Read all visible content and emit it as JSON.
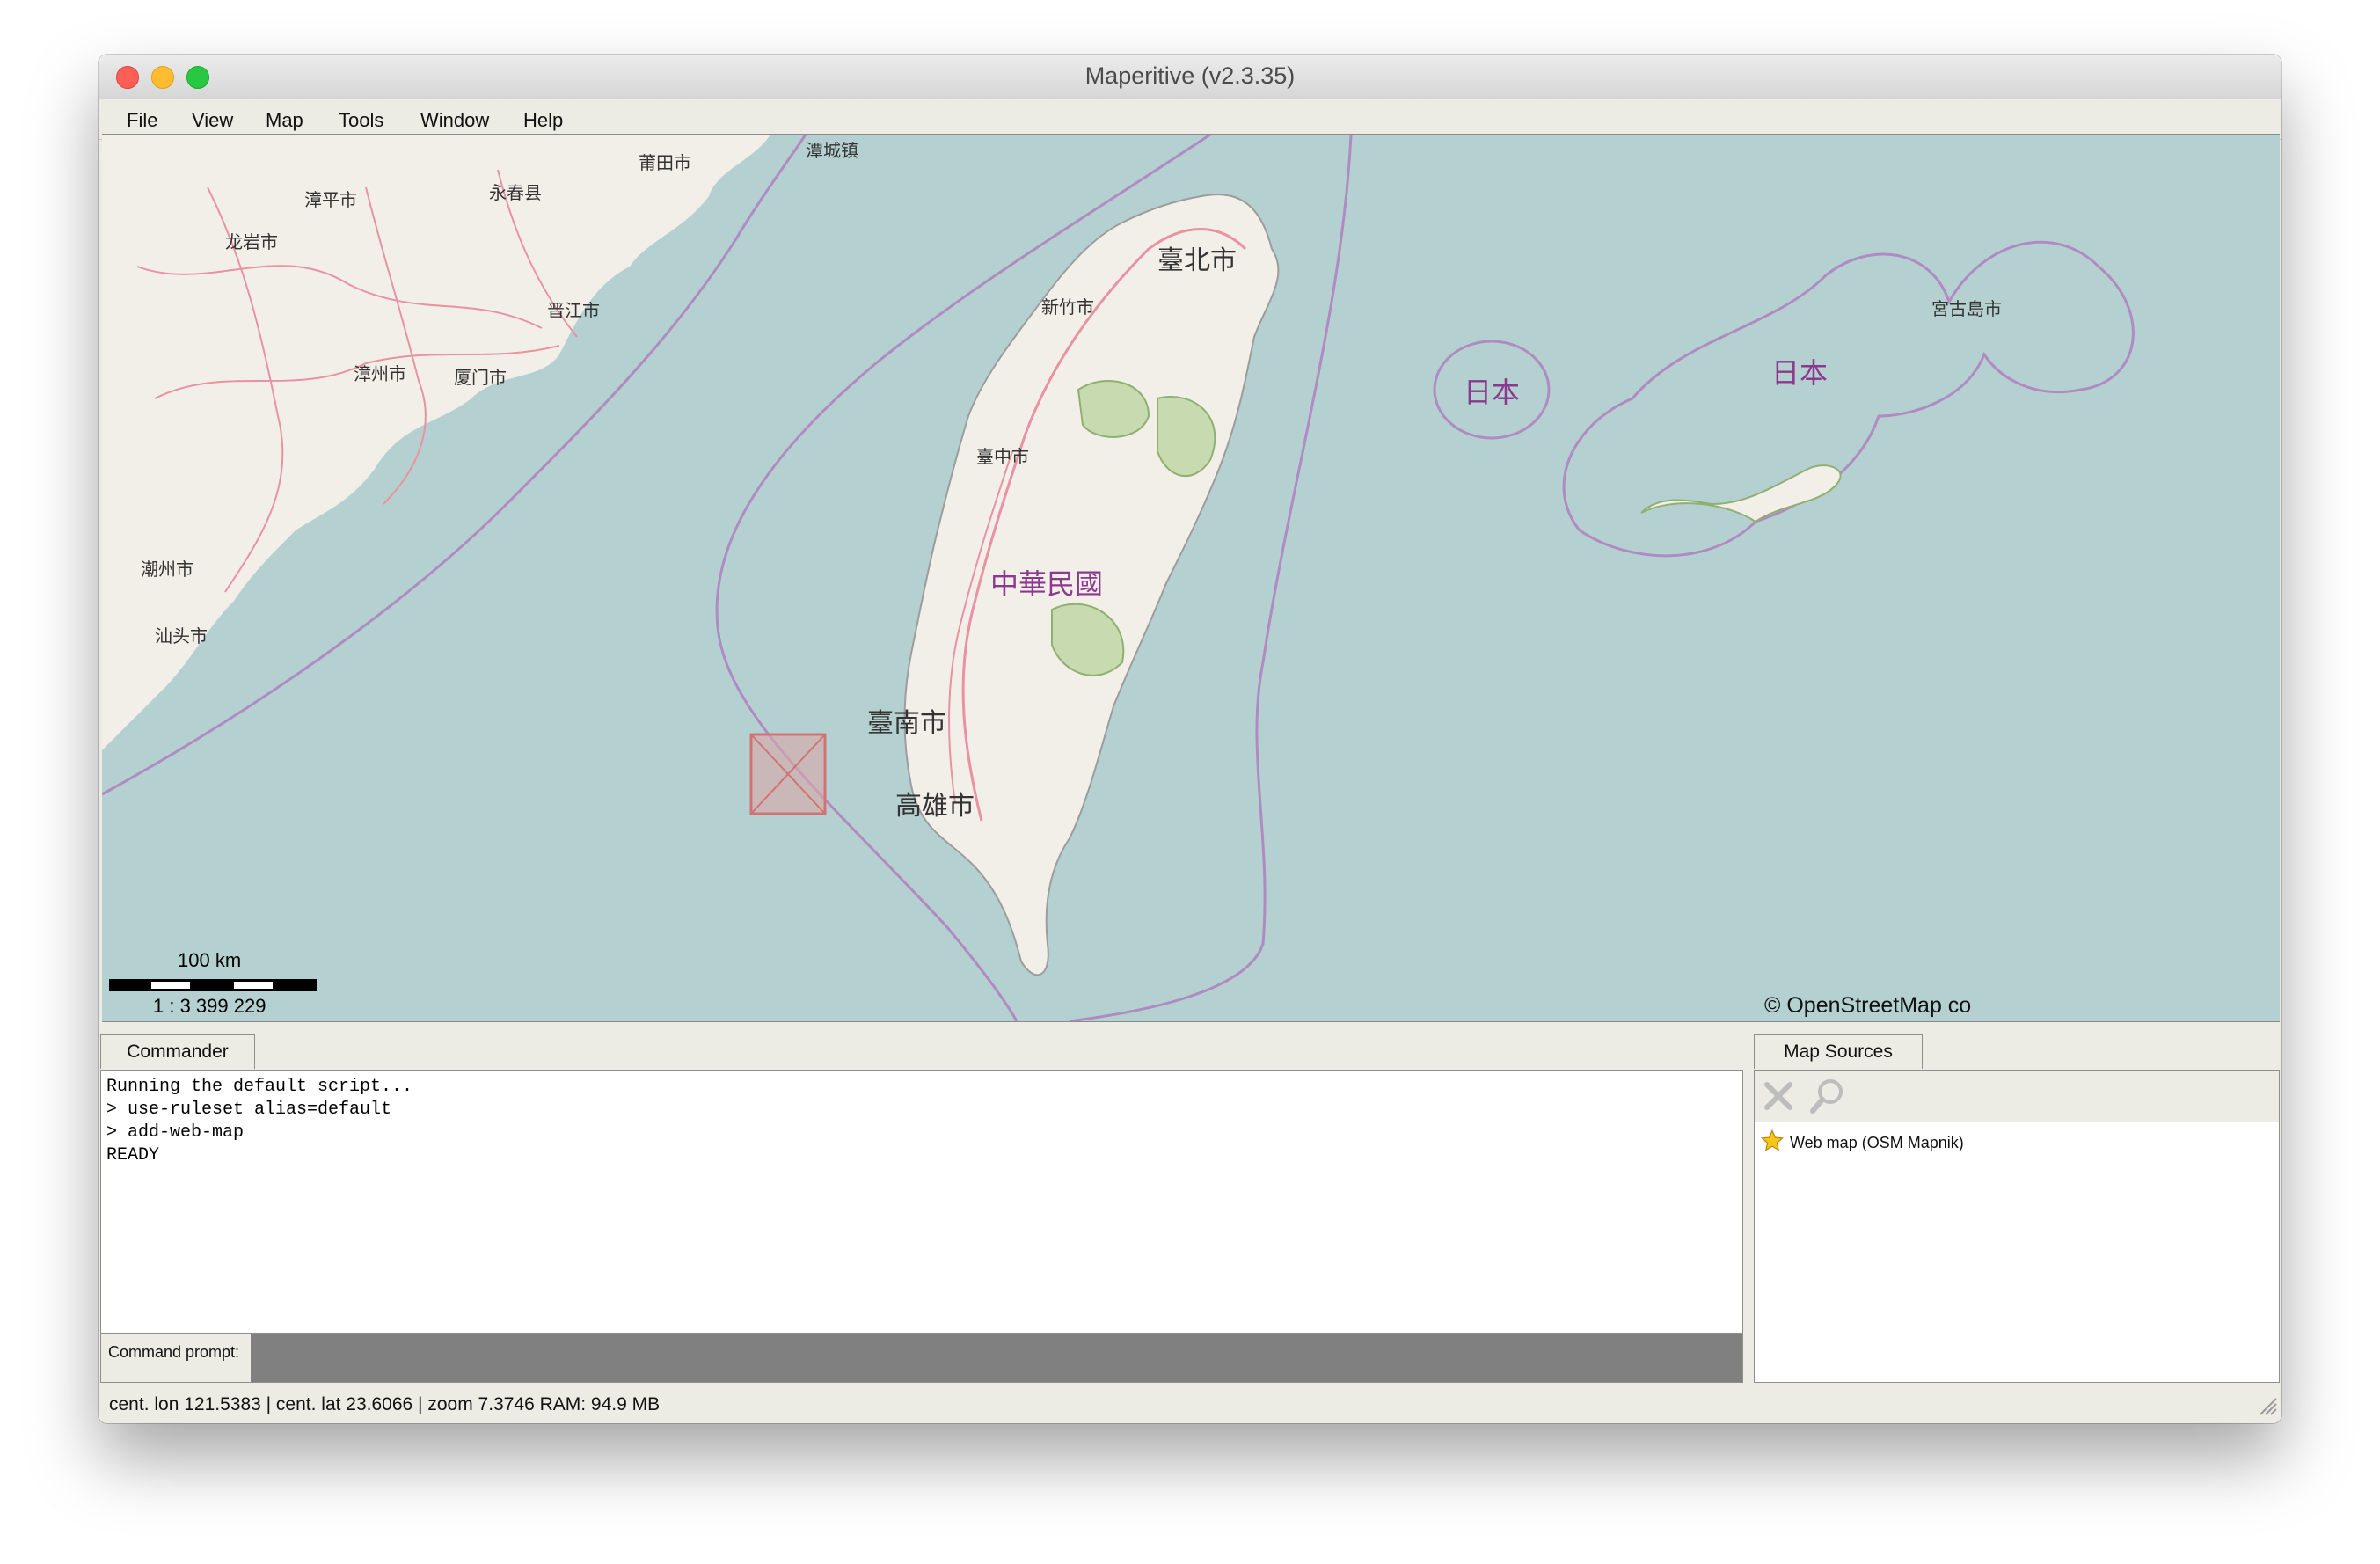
{
  "window": {
    "title": "Maperitive (v2.3.35)"
  },
  "menu": [
    "File",
    "View",
    "Map",
    "Tools",
    "Window",
    "Help"
  ],
  "map": {
    "scale_distance": "100 km",
    "scale_ratio": "1 : 3 399 229",
    "attribution": "© OpenStreetMap co",
    "places": {
      "putian": "莆田市",
      "tancheng": "潭城镇",
      "zhangping": "漳平市",
      "yongchun": "永春县",
      "longyan": "龙岩市",
      "jinjiang": "晋江市",
      "zhangzhou": "漳州市",
      "xiamen": "厦门市",
      "chaozhou": "潮州市",
      "shantou": "汕头市",
      "taipei": "臺北市",
      "hsinchu": "新竹市",
      "taichung": "臺中市",
      "roc": "中華民國",
      "tainan": "臺南市",
      "kaohsiung": "高雄市",
      "japan1": "日本",
      "japan2": "日本",
      "miyakojima": "宮古島市"
    },
    "colors": {
      "sea": "#b5d0d0",
      "land": "#f2efe9",
      "border": "#b08bc2",
      "road": "#e892a2",
      "park": "#c8dbb0"
    }
  },
  "commander": {
    "tab_label": "Commander",
    "lines": [
      "Running the default script...",
      "> use-ruleset alias=default",
      "> add-web-map",
      "READY"
    ],
    "prompt_label": "Command prompt:",
    "prompt_value": ""
  },
  "map_sources": {
    "tab_label": "Map Sources",
    "toolbar_icons": [
      "remove-icon",
      "zoom-to-source-icon"
    ],
    "items": [
      {
        "label": "Web map (OSM Mapnik)",
        "icon": "star-icon"
      }
    ]
  },
  "status": {
    "text": "cent. lon 121.5383 | cent. lat 23.6066 | zoom 7.3746    RAM: 94.9 MB"
  }
}
